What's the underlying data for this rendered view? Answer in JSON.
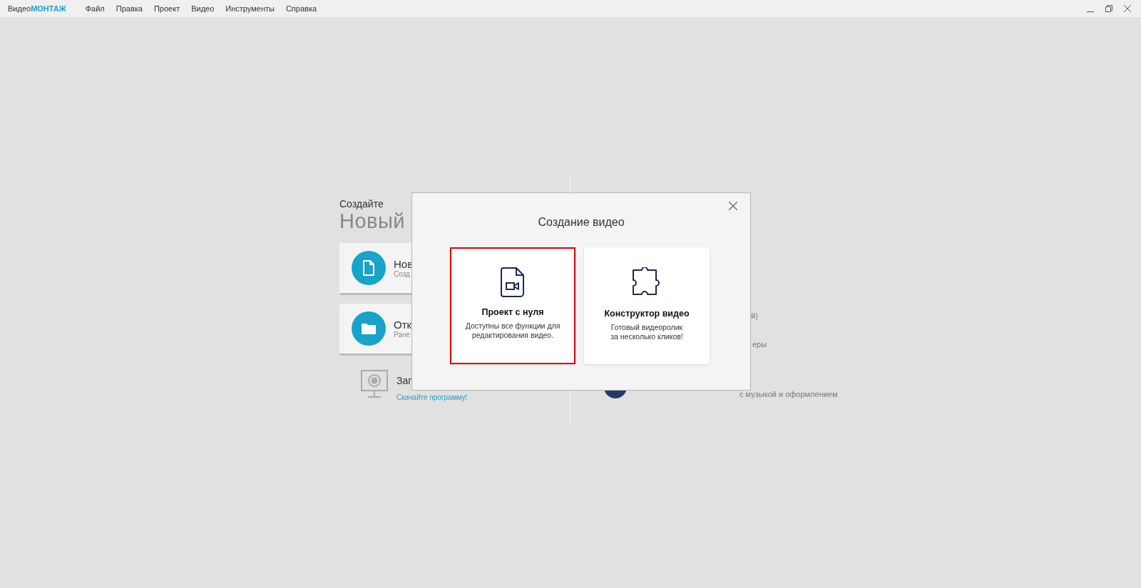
{
  "app_bar": {
    "logo": {
      "prefix": "Видео",
      "accent": "МОНТАЖ"
    },
    "menu": [
      "Файл",
      "Правка",
      "Проект",
      "Видео",
      "Инструменты",
      "Справка"
    ]
  },
  "home": {
    "left": {
      "heading": "Создайте",
      "title": "Новый",
      "actions": [
        {
          "kind": "new",
          "title": "Нов",
          "subtitle": "Созд"
        },
        {
          "kind": "open",
          "title": "Отк",
          "subtitle": "Ране"
        }
      ],
      "promo": {
        "title": "Зап",
        "link": "Скачайте программу!"
      }
    },
    "right": {
      "fragments": [
        "й)",
        "еры",
        "с музыкой и оформлением"
      ]
    }
  },
  "dialog": {
    "title": "Создание видео",
    "options": [
      {
        "kind": "scratch",
        "title": "Проект с нуля",
        "description": "Доступны все функции для\nредактирования видео.",
        "selected": true
      },
      {
        "kind": "builder",
        "title": "Конструктор видео",
        "description": "Готовый видеоролик\nза несколько кликов!",
        "selected": false
      }
    ]
  }
}
